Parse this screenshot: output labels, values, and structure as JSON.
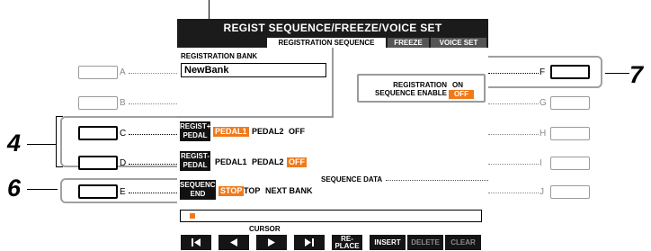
{
  "screen": {
    "title": "REGIST SEQUENCE/FREEZE/VOICE SET",
    "tabs": [
      {
        "label": "REGISTRATION SEQUENCE",
        "active": true
      },
      {
        "label": "FREEZE",
        "active": false
      },
      {
        "label": "VOICE SET",
        "active": false
      }
    ],
    "registration_bank": {
      "label": "REGISTRATION BANK",
      "value": "NewBank"
    },
    "regist_plus_pedal": {
      "tag_line1": "REGIST+",
      "tag_line2": "PEDAL",
      "options": [
        {
          "label": "PEDAL1",
          "selected": true
        },
        {
          "label": "PEDAL2",
          "selected": false
        },
        {
          "label": "OFF",
          "selected": false
        }
      ]
    },
    "regist_minus_pedal": {
      "tag_line1": "REGIST-",
      "tag_line2": "PEDAL",
      "options": [
        {
          "label": "PEDAL1",
          "selected": false
        },
        {
          "label": "PEDAL2",
          "selected": false
        },
        {
          "label": "OFF",
          "selected": true
        }
      ]
    },
    "sequence_end": {
      "tag_line1": "SEQUENCE",
      "tag_line2": "END",
      "options": [
        {
          "label": "STOP",
          "selected": true
        },
        {
          "label": "TOP",
          "selected": false
        },
        {
          "label": "NEXT BANK",
          "selected": false
        }
      ]
    },
    "registration_sequence_enable": {
      "label_line1": "REGISTRATION",
      "label_line2": "SEQUENCE ENABLE",
      "on_label": "ON",
      "off_label": "OFF",
      "selected": "OFF"
    },
    "sequence_data_label": "SEQUENCE DATA",
    "cursor_label": "CURSOR",
    "buttons": {
      "first": "first-icon",
      "prev": "left-triangle-icon",
      "next": "right-triangle-icon",
      "last": "last-icon",
      "replace_line1": "RE-",
      "replace_line2": "PLACE",
      "insert": "INSERT",
      "delete": "DELETE",
      "clear": "CLEAR"
    }
  },
  "panel_left": [
    "A",
    "B",
    "C",
    "D",
    "E"
  ],
  "panel_right": [
    "F",
    "G",
    "H",
    "I",
    "J"
  ],
  "callouts": [
    "4",
    "6",
    "7"
  ],
  "colors": {
    "accent": "#f07a1a",
    "lcd_dark": "#1b1b1b"
  }
}
